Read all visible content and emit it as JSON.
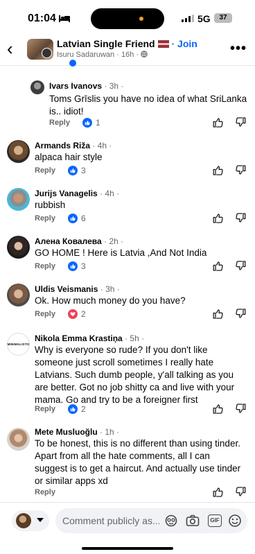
{
  "status_bar": {
    "time": "01:04",
    "network": "5G",
    "battery": "37"
  },
  "header": {
    "group_name": "Latvian  Single Friend",
    "join_label": "· Join",
    "author": "Isuru Sadaruwan",
    "time": "16h"
  },
  "comments": [
    {
      "name": "Ivars Ivanovs",
      "time": "3h",
      "text": "Toms Grīslis you have no idea of what SriLanka is.. idiot!",
      "reply": "Reply",
      "reaction": "like",
      "count": "1"
    },
    {
      "name": "Armands Riža",
      "time": "4h",
      "text": "alpaca hair style",
      "reply": "Reply",
      "reaction": "like",
      "count": "3"
    },
    {
      "name": "Jurijs Vanagelis",
      "time": "4h",
      "text": "rubbish",
      "reply": "Reply",
      "reaction": "like",
      "count": "6"
    },
    {
      "name": "Алена Ковалева",
      "time": "2h",
      "text": "GO HOME ! Here is Latvia ,And Not India",
      "reply": "Reply",
      "reaction": "like",
      "count": "3"
    },
    {
      "name": "Uldis Veismanis",
      "time": "3h",
      "text": "Ok. How much money do you have?",
      "reply": "Reply",
      "reaction": "love",
      "count": "2"
    },
    {
      "name": "Nikola Emma Krastiņa",
      "time": "5h",
      "text": "Why is everyone so rude? If you don't like someone just scroll sometimes I really hate Latvians. Such dumb people, y'all talking as you are better. Got no job shitty ca and live with your mama. Go and try to be a foreigner first",
      "reply": "Reply",
      "reaction": "like",
      "count": "2",
      "avatar_text": "MINIMALISTO"
    },
    {
      "name": "Mete Musluoğlu",
      "time": "1h",
      "text": "To be honest, this is no different than using tinder. Apart from all the hate comments, all I can suggest is to get a haircut. And actually use tinder or similar apps xd",
      "reply": "Reply",
      "reaction": "",
      "count": ""
    }
  ],
  "footer": {
    "placeholder": "Comment publicly as...",
    "gif_label": "GIF"
  },
  "colors": {
    "accent": "#0866ff",
    "secondary_text": "#65676b",
    "love": "#f33e58"
  }
}
